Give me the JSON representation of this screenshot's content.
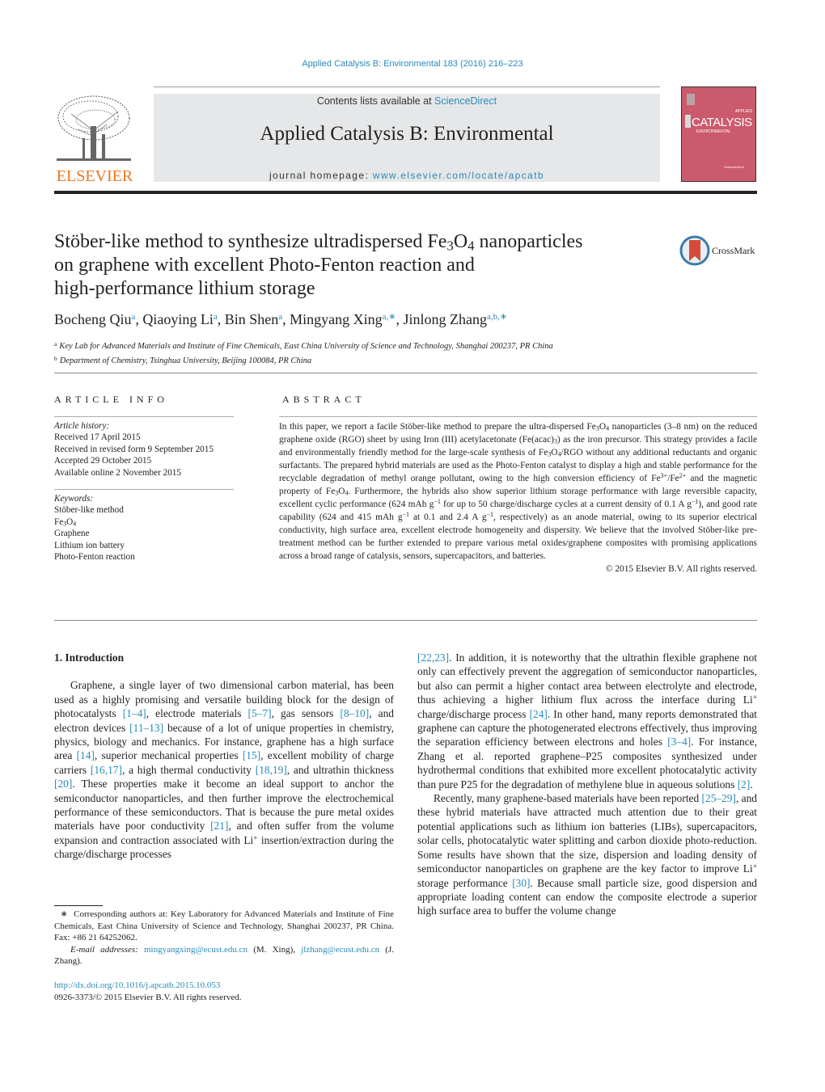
{
  "header": {
    "journal_reference": "Applied Catalysis B: Environmental 183 (2016) 216–223",
    "contents_prefix": "Contents lists available at ",
    "contents_link": "ScienceDirect",
    "journal_title": "Applied Catalysis B: Environmental",
    "homepage_prefix": "journal homepage: ",
    "homepage_link": "www.elsevier.com/locate/apcatb",
    "publisher_logo": "ELSEVIER",
    "cover_title": "CATALYSIS",
    "cover_line1": "APPLIED",
    "cover_line2": "ENVIRONMENTAL",
    "cover_line3": "ScienceDirect",
    "crossmark_label": "CrossMark",
    "brand_colors": {
      "link": "#2a8ab8",
      "elsevier_orange": "#e87722",
      "cover_pink": "#cb5a6c",
      "banner_gray": "#e6e7e8"
    }
  },
  "article": {
    "title_part1": "Stöber-like method to synthesize ultradispersed Fe",
    "title_sub1": "3",
    "title_part2": "O",
    "title_sub2": "4",
    "title_part3": " nanoparticles",
    "title_line2": "on graphene with excellent Photo-Fenton reaction and",
    "title_line3": "high-performance lithium storage",
    "authors": [
      {
        "name": "Bocheng Qiu",
        "marks": "a",
        "sep": ", "
      },
      {
        "name": "Qiaoying Li",
        "marks": "a",
        "sep": ", "
      },
      {
        "name": "Bin Shen",
        "marks": "a",
        "sep": ", "
      },
      {
        "name": "Mingyang Xing",
        "marks": "a,∗",
        "sep": ", "
      },
      {
        "name": "Jinlong Zhang",
        "marks": "a,b,∗",
        "sep": ""
      }
    ],
    "affiliations": [
      {
        "label": "a",
        "text": "Key Lab for Advanced Materials and Institute of Fine Chemicals, East China University of Science and Technology, Shanghai 200237, PR China"
      },
      {
        "label": "b",
        "text": "Department of Chemistry, Tsinghua University, Beijing 100084, PR China"
      }
    ]
  },
  "article_info": {
    "heading": "ARTICLE INFO",
    "history_label": "Article history:",
    "history": [
      "Received 17 April 2015",
      "Received in revised form 9 September 2015",
      "Accepted 29 October 2015",
      "Available online 2 November 2015"
    ],
    "keywords_label": "Keywords:",
    "keywords": [
      "Stöber-like method",
      "Fe3O4",
      "Graphene",
      "Lithium ion battery",
      "Photo-Fenton reaction"
    ]
  },
  "abstract": {
    "heading": "ABSTRACT",
    "s1": "In this paper, we report a facile Stöber-like method to prepare the ultra-dispersed Fe",
    "s2": " nanoparticles (3–8 nm) on the reduced graphene oxide (RGO) sheet by using Iron (III) acetylacetonate (Fe(acac)",
    "s3": ") as the iron precursor. This strategy provides a facile and environmentally friendly method for the large-scale synthesis of Fe",
    "s4": "/RGO without any additional reductants and organic surfactants. The prepared hybrid materials are used as the Photo-Fenton catalyst to display a high and stable performance for the recyclable degradation of methyl orange pollutant, owing to the high conversion efficiency of Fe",
    "s5": "/Fe",
    "s6": " and the magnetic property of Fe",
    "s7": ". Furthermore, the hybrids also show superior lithium storage performance with large reversible capacity, excellent cyclic performance (624 mAh g",
    "s8": " for up to 50 charge/discharge cycles at a current density of 0.1 A g",
    "s9": "), and good rate capability (624 and 415 mAh g",
    "s10": " at 0.1 and 2.4 A g",
    "s11": ", respectively) as an anode material, owing to its superior electrical conductivity, high surface area, excellent electrode homogeneity and dispersity. We believe that the involved Stöber-like pre-treatment method can be further extended to prepare various metal oxides/graphene composites with promising applications across a broad range of catalysis, sensors, supercapacitors, and batteries.",
    "copyright": "© 2015 Elsevier B.V. All rights reserved."
  },
  "introduction": {
    "heading": "1.  Introduction",
    "p1": [
      {
        "t": "Graphene, a single layer of two dimensional carbon material, has been used as a highly promising and versatile building block for the design of photocatalysts "
      },
      {
        "ref": "[1–4]"
      },
      {
        "t": ", electrode materials "
      },
      {
        "ref": "[5–7]"
      },
      {
        "t": ", gas sensors "
      },
      {
        "ref": "[8–10]"
      },
      {
        "t": ", and electron devices "
      },
      {
        "ref": "[11–13]"
      },
      {
        "t": " because of a lot of unique properties in chemistry, physics, biology and mechanics. For instance, graphene has a high surface area "
      },
      {
        "ref": "[14]"
      },
      {
        "t": ", superior mechanical properties "
      },
      {
        "ref": "[15]"
      },
      {
        "t": ", excellent mobility of charge carriers "
      },
      {
        "ref": "[16,17]"
      },
      {
        "t": ", a high thermal conductivity "
      },
      {
        "ref": "[18,19]"
      },
      {
        "t": ", and ultrathin thickness "
      },
      {
        "ref": "[20]"
      },
      {
        "t": ". These properties make it become an ideal support to anchor the semiconductor nanoparticles, and then further improve the electrochemical performance of these semiconductors. That is because the pure metal oxides materials have poor conductivity "
      },
      {
        "ref": "[21]"
      },
      {
        "t": ", and often suffer from the volume expansion and contraction associated with Li"
      },
      {
        "sup": "+"
      },
      {
        "t": " insertion/extraction during the charge/discharge processes"
      }
    ],
    "p1_cont": [
      {
        "ref": "[22,23]"
      },
      {
        "t": ". In addition, it is noteworthy that the ultrathin flexible graphene not only can effectively prevent the aggregation of semiconductor nanoparticles, but also can permit a higher contact area between electrolyte and electrode, thus achieving a higher lithium flux across the interface during Li"
      },
      {
        "sup": "+"
      },
      {
        "t": " charge/discharge process "
      },
      {
        "ref": "[24]"
      },
      {
        "t": ". In other hand, many reports demonstrated that graphene can capture the photogenerated electrons effectively, thus improving the separation efficiency between electrons and holes "
      },
      {
        "ref": "[3–4]"
      },
      {
        "t": ". For instance, Zhang et al. reported graphene–P25 composites synthesized under hydrothermal conditions that exhibited more excellent photocatalytic activity than pure P25 for the degradation of methylene blue in aqueous solutions "
      },
      {
        "ref": "[2]"
      },
      {
        "t": "."
      }
    ],
    "p2": [
      {
        "t": "Recently, many graphene-based materials have been reported "
      },
      {
        "ref": "[25–29]"
      },
      {
        "t": ", and these hybrid materials have attracted much attention due to their great potential applications such as lithium ion batteries (LIBs), supercapacitors, solar cells, photocatalytic water splitting and carbon dioxide photo-reduction. Some results have shown that the size, dispersion and loading density of semiconductor nanoparticles on graphene are the key factor to improve Li"
      },
      {
        "sup": "+"
      },
      {
        "t": " storage performance "
      },
      {
        "ref": "[30]"
      },
      {
        "t": ". Because small particle size, good dispersion and appropriate loading content can endow the composite electrode a superior high surface area to buffer the volume change"
      }
    ]
  },
  "footnote": {
    "marker": "∗",
    "text": "Corresponding authors at: Key Laboratory for Advanced Materials and Institute of Fine Chemicals, East China University of Science and Technology, Shanghai 200237, PR China. Fax: +86 21 64252062.",
    "email_label": "E-mail addresses:",
    "email1": "mingyangxing@ecust.edu.cn",
    "email1_name": " (M. Xing), ",
    "email2": "jlzhang@ecust.edu.cn",
    "email2_name": " (J. Zhang)."
  },
  "doi": {
    "link": "http://dx.doi.org/10.1016/j.apcatb.2015.10.053",
    "issn_line": "0926-3373/© 2015 Elsevier B.V. All rights reserved."
  }
}
